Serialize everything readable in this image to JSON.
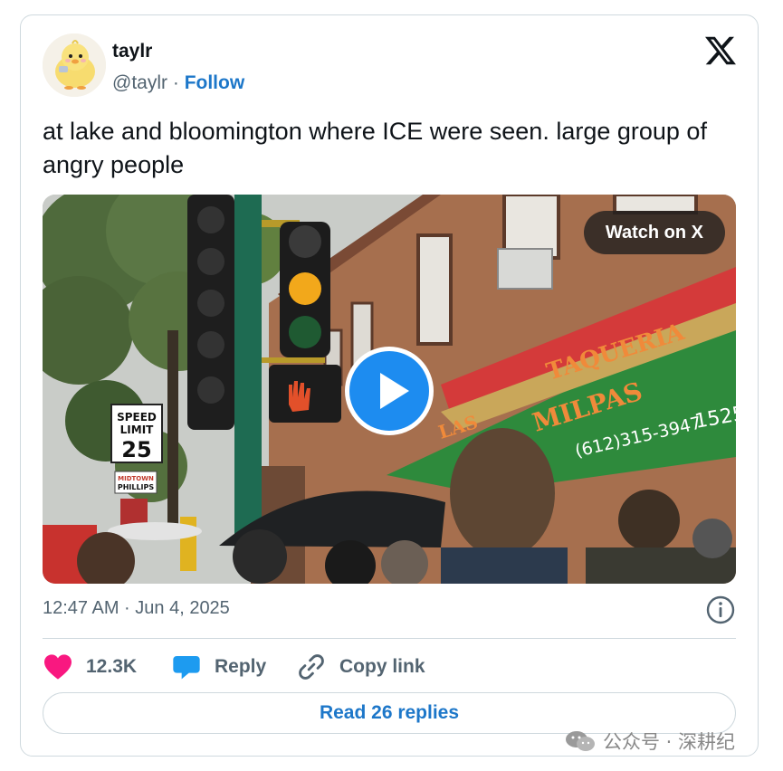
{
  "author": {
    "name": "taylr",
    "handle": "@taylr",
    "separator": "·",
    "follow_label": "Follow"
  },
  "platform": {
    "icon": "x-logo-icon"
  },
  "tweet": {
    "text": "at lake and bloomington where ICE were seen. large group of angry people"
  },
  "media": {
    "watch_label": "Watch on X",
    "play_icon": "play-icon",
    "sign_speed_line1": "SPEED",
    "sign_speed_line2": "LIMIT",
    "sign_speed_value": "25",
    "sign_midtown_line1": "MIDTOWN",
    "sign_midtown_line2": "PHILLIPS",
    "awning_name1": "TAQUERIA",
    "awning_name2": "LAS",
    "awning_name3": "MILPAS",
    "awning_phone": "(612)315-3947",
    "awning_number": "1525"
  },
  "meta": {
    "timestamp": "12:47 AM · Jun 4, 2025",
    "info_icon": "info-icon"
  },
  "actions": {
    "likes_count": "12.3K",
    "reply_label": "Reply",
    "copy_label": "Copy link",
    "read_replies_label": "Read 26 replies"
  },
  "colors": {
    "accent": "#1d77c9",
    "heart": "#f91880",
    "reply_bubble": "#1d9bf0",
    "muted": "#536471",
    "border": "#cfd9de"
  },
  "watermark": {
    "text": "公众号 · 深耕纪"
  }
}
